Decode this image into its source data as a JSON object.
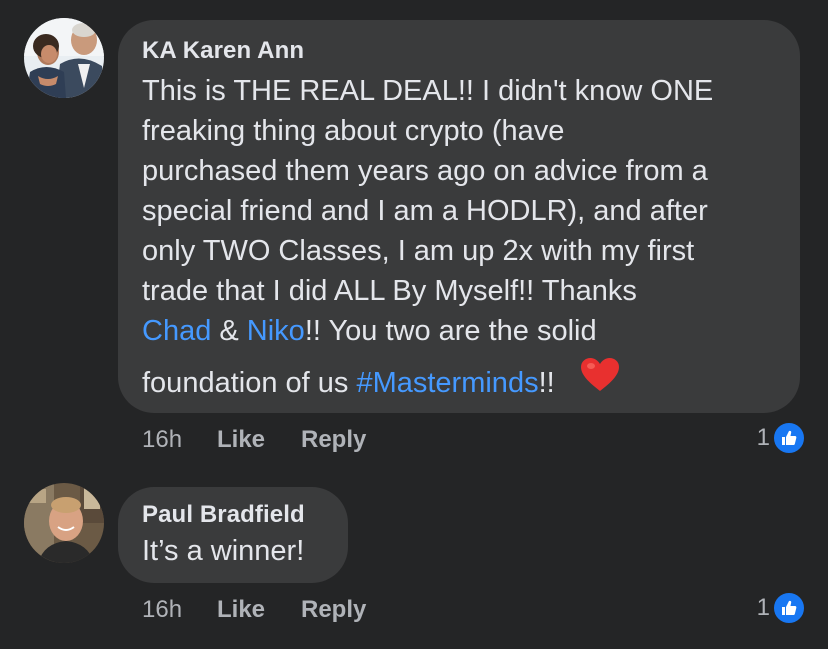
{
  "comments": [
    {
      "author": "KA Karen Ann",
      "text_lines": [
        "This is THE REAL DEAL!!  I didn't know ONE",
        "freaking thing about crypto (have",
        "purchased them years ago on advice from a",
        "special friend and I am a HODLR), and after",
        "only TWO Classes, I am up 2x with my first",
        "trade that I did ALL By Myself!!  Thanks"
      ],
      "line7": {
        "mention1": "Chad",
        "amp": " & ",
        "mention2": "Niko",
        "rest": "!!  You two are the solid"
      },
      "line8": {
        "prefix": "foundation of us ",
        "hashtag": "#Masterminds",
        "suffix": "!!",
        "emoji": "red-heart"
      },
      "time": "16h",
      "like_label": "Like",
      "reply_label": "Reply",
      "reaction_count": "1",
      "reaction_icon": "thumbs-up"
    },
    {
      "author": "Paul Bradfield",
      "text_lines": [
        "It’s a winner!"
      ],
      "time": "16h",
      "like_label": "Like",
      "reply_label": "Reply",
      "reaction_count": "1",
      "reaction_icon": "thumbs-up"
    }
  ],
  "colors": {
    "background": "#242526",
    "bubble": "#3a3b3c",
    "text": "#e4e6eb",
    "secondary_text": "#b0b3b8",
    "link": "#4599ff",
    "like_badge": "#1877f2",
    "heart": "#e8302f"
  }
}
